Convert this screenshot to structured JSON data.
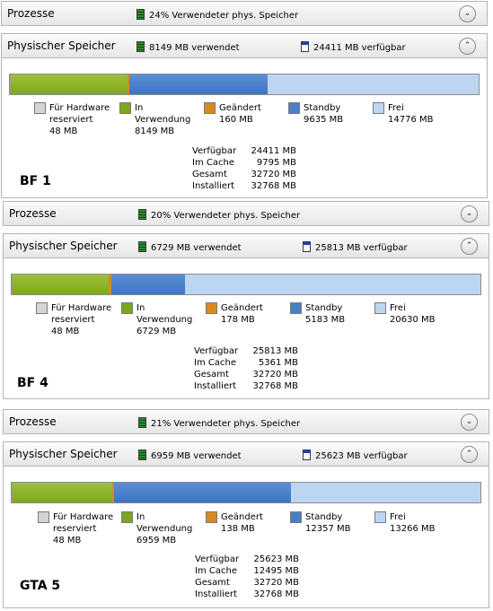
{
  "sections": [
    {
      "processes": {
        "title": "Prozesse",
        "summary": "24% Verwendeter phys. Speicher"
      },
      "memory": {
        "title": "Physischer Speicher",
        "used": "8149 MB verwendet",
        "available": "24411 MB verfügbar",
        "fractions": {
          "reserved": 0.0015,
          "in_use": 0.2487,
          "modified": 0.0049,
          "standby": 0.294,
          "free": 0.4509
        },
        "legend": [
          {
            "label": "Für Hardware\nreserviert",
            "value": "48 MB"
          },
          {
            "label": "In\nVerwendung",
            "value": "8149 MB"
          },
          {
            "label": "Geändert",
            "value": "160 MB"
          },
          {
            "label": "Standby",
            "value": "9635 MB"
          },
          {
            "label": "Frei",
            "value": "14776 MB"
          }
        ],
        "stats": [
          {
            "key": "Verfügbar",
            "value": "24411 MB"
          },
          {
            "key": "Im Cache",
            "value": "9795 MB"
          },
          {
            "key": "Gesamt",
            "value": "32720 MB"
          },
          {
            "key": "Installiert",
            "value": "32768 MB"
          }
        ]
      },
      "tag": "BF 1"
    },
    {
      "processes": {
        "title": "Prozesse",
        "summary": "20% Verwendeter phys. Speicher"
      },
      "memory": {
        "title": "Physischer Speicher",
        "used": "6729 MB verwendet",
        "available": "25813 MB verfügbar",
        "fractions": {
          "reserved": 0.0015,
          "in_use": 0.2054,
          "modified": 0.0054,
          "standby": 0.1582,
          "free": 0.6295
        },
        "legend": [
          {
            "label": "Für Hardware\nreserviert",
            "value": "48 MB"
          },
          {
            "label": "In\nVerwendung",
            "value": "6729 MB"
          },
          {
            "label": "Geändert",
            "value": "178 MB"
          },
          {
            "label": "Standby",
            "value": "5183 MB"
          },
          {
            "label": "Frei",
            "value": "20630 MB"
          }
        ],
        "stats": [
          {
            "key": "Verfügbar",
            "value": "25813 MB"
          },
          {
            "key": "Im Cache",
            "value": "5361 MB"
          },
          {
            "key": "Gesamt",
            "value": "32720 MB"
          },
          {
            "key": "Installiert",
            "value": "32768 MB"
          }
        ]
      },
      "tag": "BF 4"
    },
    {
      "processes": {
        "title": "Prozesse",
        "summary": "21% Verwendeter phys. Speicher"
      },
      "memory": {
        "title": "Physischer Speicher",
        "used": "6959 MB verwendet",
        "available": "25623 MB verfügbar",
        "fractions": {
          "reserved": 0.0015,
          "in_use": 0.2124,
          "modified": 0.0042,
          "standby": 0.3771,
          "free": 0.4048
        },
        "legend": [
          {
            "label": "Für Hardware\nreserviert",
            "value": "48 MB"
          },
          {
            "label": "In\nVerwendung",
            "value": "6959 MB"
          },
          {
            "label": "Geändert",
            "value": "138 MB"
          },
          {
            "label": "Standby",
            "value": "12357 MB"
          },
          {
            "label": "Frei",
            "value": "13266 MB"
          }
        ],
        "stats": [
          {
            "key": "Verfügbar",
            "value": "25623 MB"
          },
          {
            "key": "Im Cache",
            "value": "12495 MB"
          },
          {
            "key": "Gesamt",
            "value": "32720 MB"
          },
          {
            "key": "Installiert",
            "value": "32768 MB"
          }
        ]
      },
      "tag": "GTA 5"
    }
  ],
  "icons": {
    "expand": "chevron-down-icon",
    "collapse": "chevron-up-icon",
    "used": "memory-used-icon",
    "available": "memory-available-icon"
  },
  "colors": {
    "reserved": "#9a9a9a",
    "in_use": "#7ea61c",
    "modified": "#d98a1a",
    "standby": "#4a7ec8",
    "free": "#bcd6f1"
  }
}
